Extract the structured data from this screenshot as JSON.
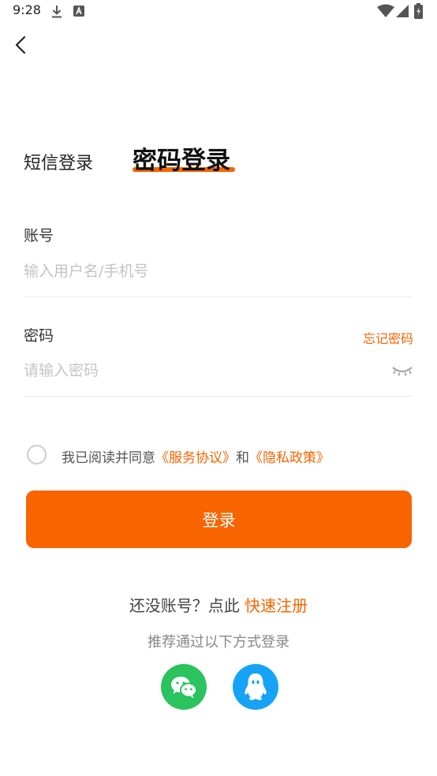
{
  "status_bar": {
    "time": "9:28",
    "icons": [
      "download-icon",
      "a-badge-icon",
      "wifi-icon",
      "signal-icon",
      "battery-icon"
    ]
  },
  "nav": {
    "back_icon": "chevron-left-icon"
  },
  "tabs": {
    "sms_label": "短信登录",
    "password_label": "密码登录",
    "active": "password"
  },
  "account": {
    "label": "账号",
    "placeholder": "输入用户名/手机号",
    "value": ""
  },
  "password": {
    "label": "密码",
    "forgot_label": "忘记密码",
    "placeholder": "请输入密码",
    "value": "",
    "visibility_icon": "eye-closed-icon"
  },
  "agreement": {
    "prefix": "我已阅读并同意",
    "service_link": "《服务协议》",
    "and": "和",
    "privacy_link": "《隐私政策》",
    "checked": false
  },
  "login_button": {
    "label": "登录"
  },
  "register": {
    "prompt": "还没账号？点此",
    "link": "快速注册"
  },
  "social": {
    "title": "推荐通过以下方式登录",
    "items": [
      {
        "name": "wechat",
        "icon": "wechat-icon"
      },
      {
        "name": "qq",
        "icon": "qq-icon"
      }
    ]
  },
  "colors": {
    "accent": "#f76400",
    "wechat": "#2ac35e",
    "qq": "#16a3f5"
  }
}
